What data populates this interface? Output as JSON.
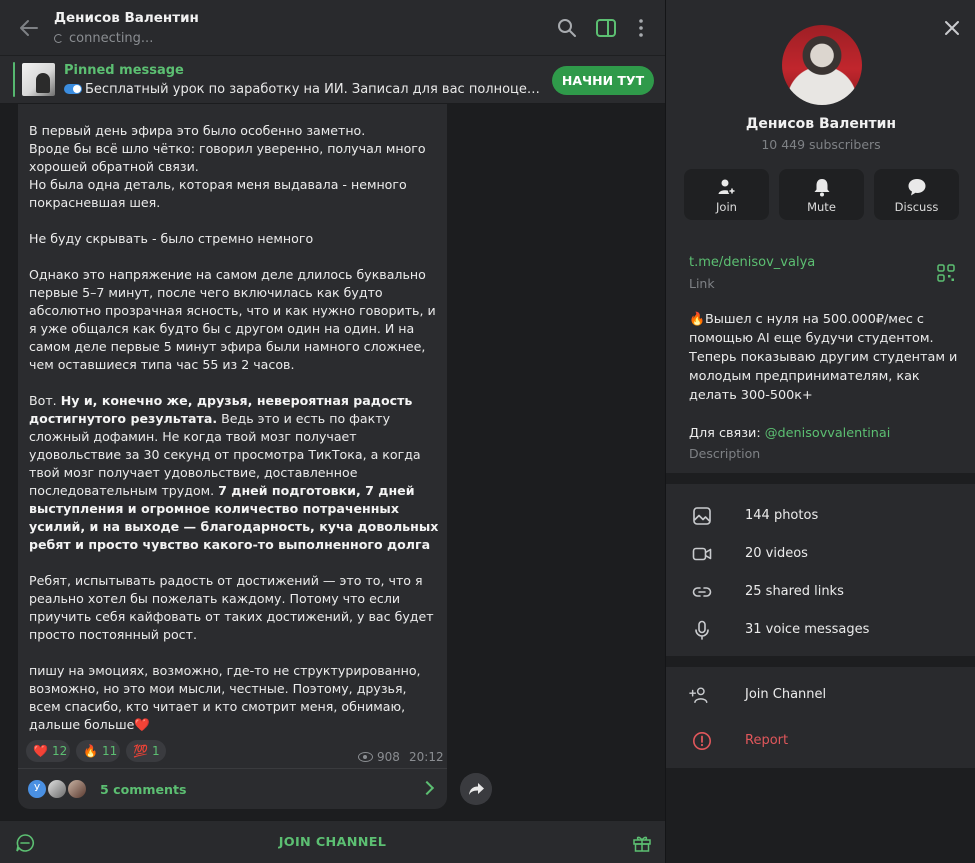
{
  "header": {
    "title": "Денисов Валентин",
    "status": "connecting..."
  },
  "pinned": {
    "title": "Pinned message",
    "text": "Бесплатный урок по заработку на ИИ.   Записал для вас полноценный урок по заработку на ИИ",
    "button": "НАЧНИ ТУТ"
  },
  "message": {
    "p1": "В первый день эфира это было особенно заметно.\nВроде бы всё шло чётко: говорил уверенно, получал много хорошей обратной связи.\nНо была одна деталь, которая меня выдавала - немного покрасневшая шея.",
    "p2": "Не буду скрывать - было стремно немного",
    "p3": "Однако это напряжение на самом деле длилось буквально первые 5–7 минут, после чего включилась как будто абсолютно прозрачная ясность, что и как нужно говорить, и я уже общался как будто бы с другом один на один. И на самом деле первые 5 минут эфира были намного сложнее, чем оставшиеся типа час 55 из 2 часов.",
    "p4_a": "Вот. ",
    "p4_b": "Ну и, конечно же, друзья, невероятная радость достигнутого результата.",
    "p4_c": " Ведь это и есть по факту сложный дофамин. Не когда твой мозг получает удовольствие за 30 секунд от просмотра ТикТока, а когда твой мозг получает удовольствие, доставленное последовательным трудом. ",
    "p4_d": "7 дней подготовки, 7 дней выступления и огромное количество потраченных усилий, и на выходе — благодарность, куча довольных ребят и просто чувство какого-то выполненного долга",
    "p5": "Ребят, испытывать радость от достижений — это то, что я реально хотел бы пожелать каждому. Потому что если приучить себя кайфовать от таких достижений, у вас будет просто постоянный рост.",
    "p6": "пишу на эмоциях, возможно, где-то не структурированно, возможно, но это мои мысли, честные. Поэтому, друзья, всем спасибо, кто читает и кто смотрит меня, обнимаю, дальше больше",
    "p6_emoji": "❤️",
    "reactions": [
      {
        "emoji": "❤️",
        "count": "12"
      },
      {
        "emoji": "🔥",
        "count": "11"
      },
      {
        "emoji": "💯",
        "count": "1"
      }
    ],
    "views": "908",
    "time": "20:12",
    "comments": "5 comments",
    "comment_avatar_letter": "У"
  },
  "bottom": {
    "join": "JOIN CHANNEL"
  },
  "profile": {
    "name": "Денисов Валентин",
    "subscribers": "10 449 subscribers",
    "actions": [
      "Join",
      "Mute",
      "Discuss"
    ],
    "link": "t.me/denisov_valya",
    "link_label": "Link",
    "desc_emoji": "🔥",
    "desc_text": "Вышел с нуля на 500.000₽/мес с помощью AI еще будучи студентом.\nТеперь показываю другим студентам и молодым предпринимателям, как делать 300-500к+",
    "desc_contact_label": "Для связи: ",
    "desc_contact": "@denisovvalentinai",
    "desc_label": "Description",
    "media": [
      "144 photos",
      "20 videos",
      "25 shared links",
      "31 voice messages"
    ],
    "join_channel": "Join Channel",
    "report": "Report"
  },
  "colors": {
    "accent": "#5cbf72",
    "button": "#2f9a4a",
    "danger": "#e0575b",
    "panel": "#292a2d"
  }
}
